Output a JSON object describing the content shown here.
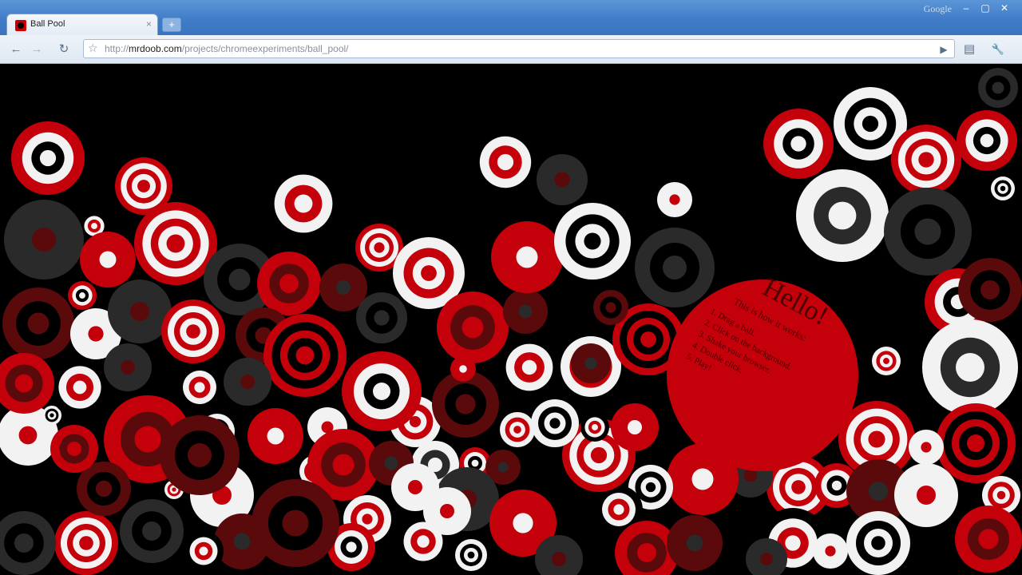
{
  "window": {
    "brand": "Google",
    "controls": {
      "minimize": "–",
      "maximize": "▢",
      "close": "✕"
    }
  },
  "tab": {
    "title": "Ball Pool",
    "close": "×",
    "new_tab": "+"
  },
  "toolbar": {
    "back": "←",
    "forward": "→",
    "reload": "↻",
    "star": "☆",
    "url_prefix": "http://",
    "url_host": "mrdoob.com",
    "url_path": "/projects/chromeexperiments/ball_pool/",
    "page_menu": "▶",
    "doc_menu": "▤",
    "wrench": "🔧"
  },
  "hello_ball": {
    "title": "Hello!",
    "subtitle": "This is how it works:",
    "steps": [
      "1. Drag a ball.",
      "2. Click on the background.",
      "3. Shake your browser.",
      "4. Double click.",
      "5. Play!"
    ]
  },
  "colors": {
    "red": "#c4000a",
    "dark_red": "#5a0a0a",
    "white": "#f2f2f2",
    "dark": "#2a2a2a",
    "black": "#000000"
  }
}
